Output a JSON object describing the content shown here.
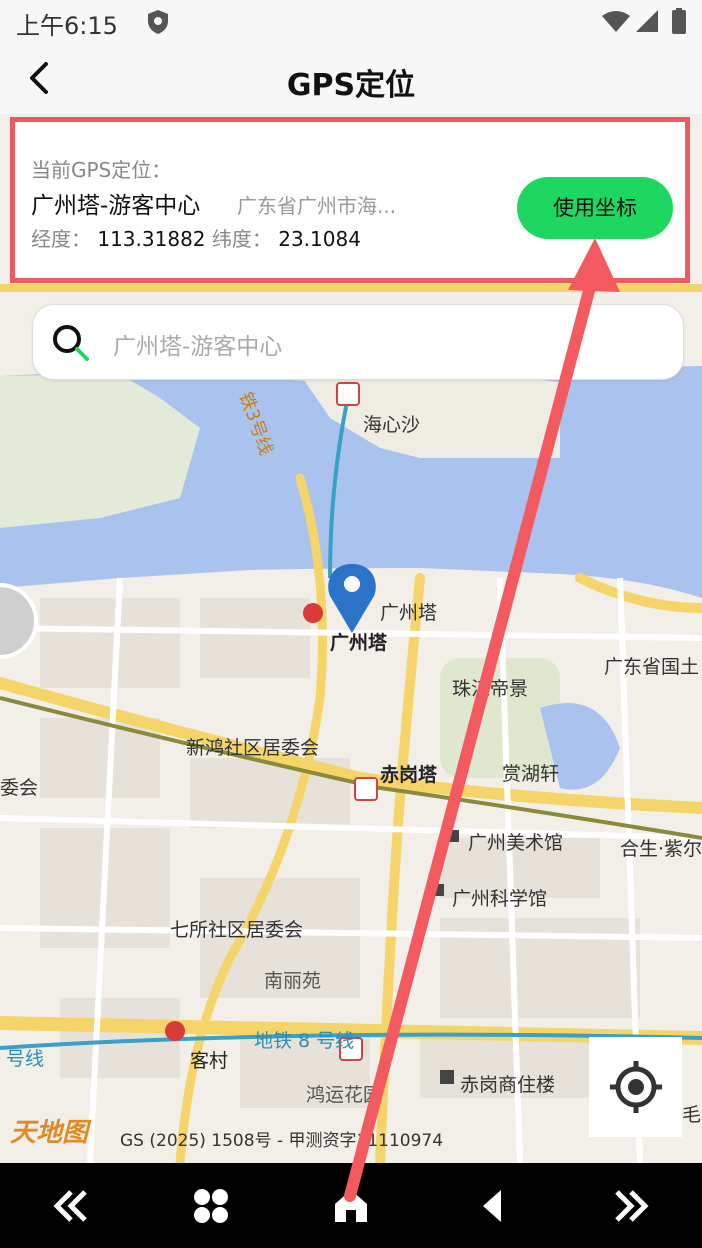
{
  "status_bar": {
    "time": "上午6:15"
  },
  "header": {
    "title": "GPS定位"
  },
  "gps_card": {
    "label": "当前GPS定位：",
    "place_name": "广州塔-游客中心",
    "address": "广东省广州市海...",
    "longitude_label": "经度：",
    "longitude": "113.31882",
    "latitude_label": "纬度：",
    "latitude": "23.1084",
    "use_button": "使用坐标"
  },
  "search": {
    "placeholder": "广州塔-游客中心"
  },
  "map_labels": {
    "haixinsha": "海心沙",
    "canton_tower_1": "广州塔",
    "canton_tower_2": "广州塔",
    "guangdong_gov": "广东省国土",
    "zhujiang": "珠江帝景",
    "xinhong": "新鸿社区居委会",
    "chigangta": "赤岗塔",
    "shanghuxuan": "赏湖轩",
    "art_museum": "广州美术馆",
    "heshengzijing": "合生·紫尔",
    "science_museum": "广州科学馆",
    "qisuo": "七所社区居委会",
    "nanliyuan": "南丽苑",
    "metro8": "地铁 8 号线",
    "kecun": "客村",
    "hongyun": "鸿运花园",
    "chigang_commercial": "赤岗商住楼",
    "metro3": "铁3号线",
    "left_weihui": "委会",
    "left_hao": "号线",
    "right_mao": "毛"
  },
  "attribution": {
    "logo": "天地图",
    "text": "GS (2025) 1508号 - 甲测资字11110974"
  },
  "colors": {
    "accent_green": "#1ed760",
    "highlight_red": "#ee5a5f",
    "water": "#a9c3ee",
    "road_yellow": "#f5d56a",
    "marker_blue": "#2a73c7"
  }
}
